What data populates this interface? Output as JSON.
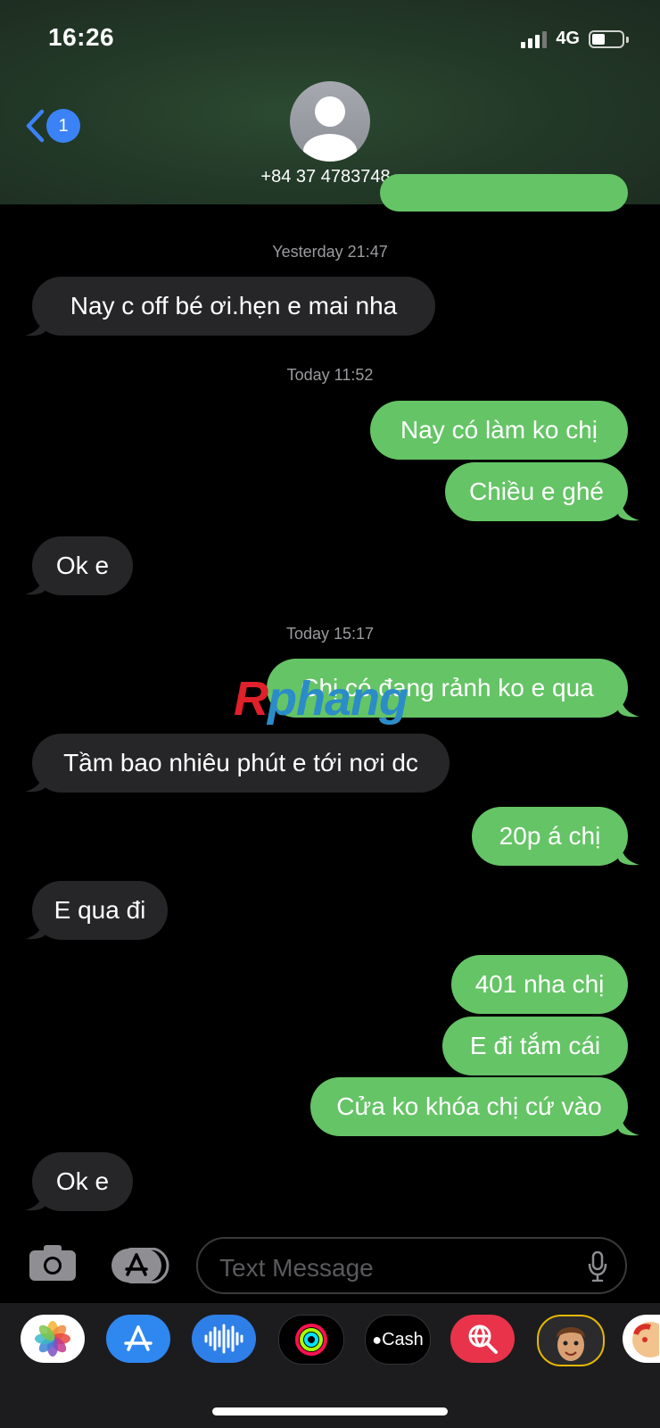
{
  "status_bar": {
    "time": "16:26",
    "network": "4G"
  },
  "header": {
    "back_badge": "1",
    "contact": "+84 37 4783748"
  },
  "thread": {
    "stamp1": "Yesterday 21:47",
    "m1": "Nay c off bé ơi.hẹn e mai nha",
    "stamp2": "Today 11:52",
    "m2": "Nay có làm ko chị",
    "m3": "Chiều e ghé",
    "m4": "Ok e",
    "stamp3": "Today 15:17",
    "m5": "Chị có đang rảnh ko e qua",
    "m6": "Tầm bao nhiêu phút e tới nơi dc",
    "m7": "20p á chị",
    "m8": "E qua đi",
    "m9": "401 nha chị",
    "m10": "E đi tắm cái",
    "m11": "Cửa ko khóa chị cứ vào",
    "m12": "Ok e"
  },
  "watermark": {
    "first": "R",
    "rest": "phang"
  },
  "compose": {
    "placeholder": "Text Message"
  },
  "app_tray": {
    "apps": [
      "photos-app-icon",
      "app-store-icon",
      "audio-message-icon",
      "activity-icon",
      "apple-cash-icon",
      "web-search-icon",
      "memoji-icon",
      "memoji-stickers-icon"
    ],
    "cash_label": "Cash"
  },
  "colors": {
    "incoming": "#262628",
    "outgoing": "#65c466",
    "accent": "#3b82f6"
  }
}
